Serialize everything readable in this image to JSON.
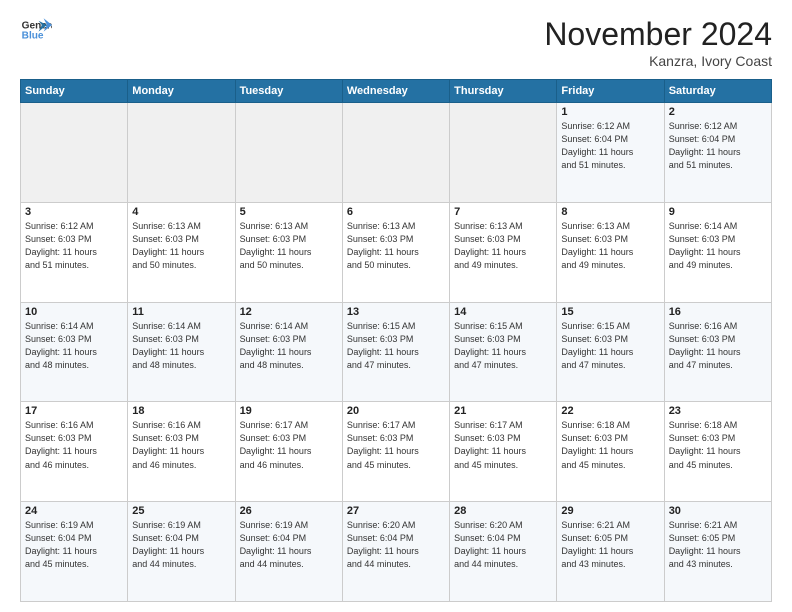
{
  "logo": {
    "line1": "General",
    "line2": "Blue"
  },
  "title": "November 2024",
  "subtitle": "Kanzra, Ivory Coast",
  "days_of_week": [
    "Sunday",
    "Monday",
    "Tuesday",
    "Wednesday",
    "Thursday",
    "Friday",
    "Saturday"
  ],
  "weeks": [
    [
      {
        "day": "",
        "info": ""
      },
      {
        "day": "",
        "info": ""
      },
      {
        "day": "",
        "info": ""
      },
      {
        "day": "",
        "info": ""
      },
      {
        "day": "",
        "info": ""
      },
      {
        "day": "1",
        "info": "Sunrise: 6:12 AM\nSunset: 6:04 PM\nDaylight: 11 hours\nand 51 minutes."
      },
      {
        "day": "2",
        "info": "Sunrise: 6:12 AM\nSunset: 6:04 PM\nDaylight: 11 hours\nand 51 minutes."
      }
    ],
    [
      {
        "day": "3",
        "info": "Sunrise: 6:12 AM\nSunset: 6:03 PM\nDaylight: 11 hours\nand 51 minutes."
      },
      {
        "day": "4",
        "info": "Sunrise: 6:13 AM\nSunset: 6:03 PM\nDaylight: 11 hours\nand 50 minutes."
      },
      {
        "day": "5",
        "info": "Sunrise: 6:13 AM\nSunset: 6:03 PM\nDaylight: 11 hours\nand 50 minutes."
      },
      {
        "day": "6",
        "info": "Sunrise: 6:13 AM\nSunset: 6:03 PM\nDaylight: 11 hours\nand 50 minutes."
      },
      {
        "day": "7",
        "info": "Sunrise: 6:13 AM\nSunset: 6:03 PM\nDaylight: 11 hours\nand 49 minutes."
      },
      {
        "day": "8",
        "info": "Sunrise: 6:13 AM\nSunset: 6:03 PM\nDaylight: 11 hours\nand 49 minutes."
      },
      {
        "day": "9",
        "info": "Sunrise: 6:14 AM\nSunset: 6:03 PM\nDaylight: 11 hours\nand 49 minutes."
      }
    ],
    [
      {
        "day": "10",
        "info": "Sunrise: 6:14 AM\nSunset: 6:03 PM\nDaylight: 11 hours\nand 48 minutes."
      },
      {
        "day": "11",
        "info": "Sunrise: 6:14 AM\nSunset: 6:03 PM\nDaylight: 11 hours\nand 48 minutes."
      },
      {
        "day": "12",
        "info": "Sunrise: 6:14 AM\nSunset: 6:03 PM\nDaylight: 11 hours\nand 48 minutes."
      },
      {
        "day": "13",
        "info": "Sunrise: 6:15 AM\nSunset: 6:03 PM\nDaylight: 11 hours\nand 47 minutes."
      },
      {
        "day": "14",
        "info": "Sunrise: 6:15 AM\nSunset: 6:03 PM\nDaylight: 11 hours\nand 47 minutes."
      },
      {
        "day": "15",
        "info": "Sunrise: 6:15 AM\nSunset: 6:03 PM\nDaylight: 11 hours\nand 47 minutes."
      },
      {
        "day": "16",
        "info": "Sunrise: 6:16 AM\nSunset: 6:03 PM\nDaylight: 11 hours\nand 47 minutes."
      }
    ],
    [
      {
        "day": "17",
        "info": "Sunrise: 6:16 AM\nSunset: 6:03 PM\nDaylight: 11 hours\nand 46 minutes."
      },
      {
        "day": "18",
        "info": "Sunrise: 6:16 AM\nSunset: 6:03 PM\nDaylight: 11 hours\nand 46 minutes."
      },
      {
        "day": "19",
        "info": "Sunrise: 6:17 AM\nSunset: 6:03 PM\nDaylight: 11 hours\nand 46 minutes."
      },
      {
        "day": "20",
        "info": "Sunrise: 6:17 AM\nSunset: 6:03 PM\nDaylight: 11 hours\nand 45 minutes."
      },
      {
        "day": "21",
        "info": "Sunrise: 6:17 AM\nSunset: 6:03 PM\nDaylight: 11 hours\nand 45 minutes."
      },
      {
        "day": "22",
        "info": "Sunrise: 6:18 AM\nSunset: 6:03 PM\nDaylight: 11 hours\nand 45 minutes."
      },
      {
        "day": "23",
        "info": "Sunrise: 6:18 AM\nSunset: 6:03 PM\nDaylight: 11 hours\nand 45 minutes."
      }
    ],
    [
      {
        "day": "24",
        "info": "Sunrise: 6:19 AM\nSunset: 6:04 PM\nDaylight: 11 hours\nand 45 minutes."
      },
      {
        "day": "25",
        "info": "Sunrise: 6:19 AM\nSunset: 6:04 PM\nDaylight: 11 hours\nand 44 minutes."
      },
      {
        "day": "26",
        "info": "Sunrise: 6:19 AM\nSunset: 6:04 PM\nDaylight: 11 hours\nand 44 minutes."
      },
      {
        "day": "27",
        "info": "Sunrise: 6:20 AM\nSunset: 6:04 PM\nDaylight: 11 hours\nand 44 minutes."
      },
      {
        "day": "28",
        "info": "Sunrise: 6:20 AM\nSunset: 6:04 PM\nDaylight: 11 hours\nand 44 minutes."
      },
      {
        "day": "29",
        "info": "Sunrise: 6:21 AM\nSunset: 6:05 PM\nDaylight: 11 hours\nand 43 minutes."
      },
      {
        "day": "30",
        "info": "Sunrise: 6:21 AM\nSunset: 6:05 PM\nDaylight: 11 hours\nand 43 minutes."
      }
    ]
  ]
}
